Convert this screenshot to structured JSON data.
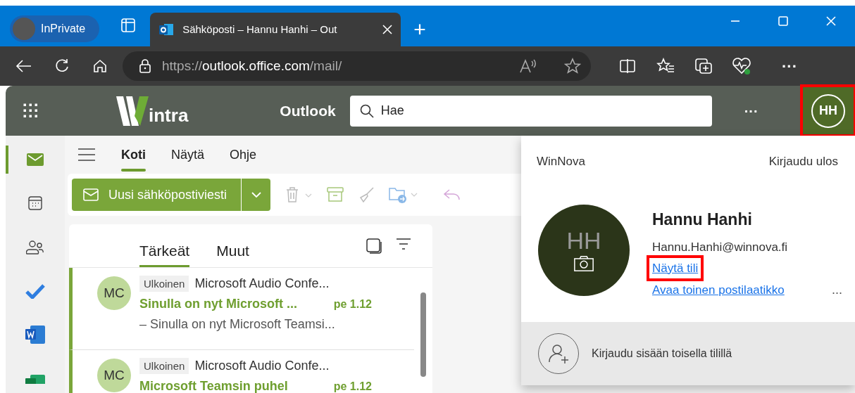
{
  "browser": {
    "profile": "InPrivate",
    "tab": {
      "title": "Sähköposti – Hannu Hanhi – Out",
      "selected": true
    },
    "new_tab": "+",
    "url": {
      "scheme": "https://",
      "host": "outlook.office.com",
      "path": "/mail/"
    },
    "more": "···"
  },
  "app_header": {
    "brand": "intra",
    "app_name": "Outlook",
    "search": {
      "placeholder": "Hae"
    },
    "more": "···",
    "account": {
      "initials": "HH",
      "highlighted": true
    }
  },
  "rail": [
    {
      "kind": "mail",
      "selected": true
    },
    {
      "kind": "calendar",
      "selected": false
    },
    {
      "kind": "people",
      "selected": false
    },
    {
      "kind": "todo",
      "selected": false
    },
    {
      "kind": "word",
      "selected": false
    },
    {
      "kind": "excel",
      "selected": false
    }
  ],
  "menu_tabs": [
    {
      "label": "Koti",
      "selected": true
    },
    {
      "label": "Näytä",
      "selected": false
    },
    {
      "label": "Ohje",
      "selected": false
    }
  ],
  "new_mail": "Uusi sähköpostiviesti",
  "inbox_tabs": [
    {
      "label": "Tärkeät",
      "selected": true
    },
    {
      "label": "Muut",
      "selected": false
    }
  ],
  "messages": [
    {
      "initials": "MC",
      "tag": "Ulkoinen",
      "sender": "Microsoft Audio Confe...",
      "subject": "Sinulla on nyt Microsoft ...",
      "date": "pe 1.12",
      "preview": "– Sinulla on nyt Microsoft Teamsi...",
      "unread": true
    },
    {
      "initials": "MC",
      "tag": "Ulkoinen",
      "sender": "Microsoft Audio Confe...",
      "subject": "Microsoft Teamsin puhel",
      "date": "pe 1.12",
      "unread": true
    }
  ],
  "account_panel": {
    "organization": "WinNova",
    "sign_out": "Kirjaudu ulos",
    "photo_initials": "HH",
    "name": "Hannu Hanhi",
    "email": "Hannu.Hanhi@winnova.fi",
    "links": [
      {
        "label": "Näytä tili",
        "highlighted": true
      },
      {
        "label": "Avaa toinen postilaatikko",
        "highlighted": false
      }
    ],
    "more": "...",
    "other_account": "Kirjaudu sisään toisella tilillä"
  }
}
